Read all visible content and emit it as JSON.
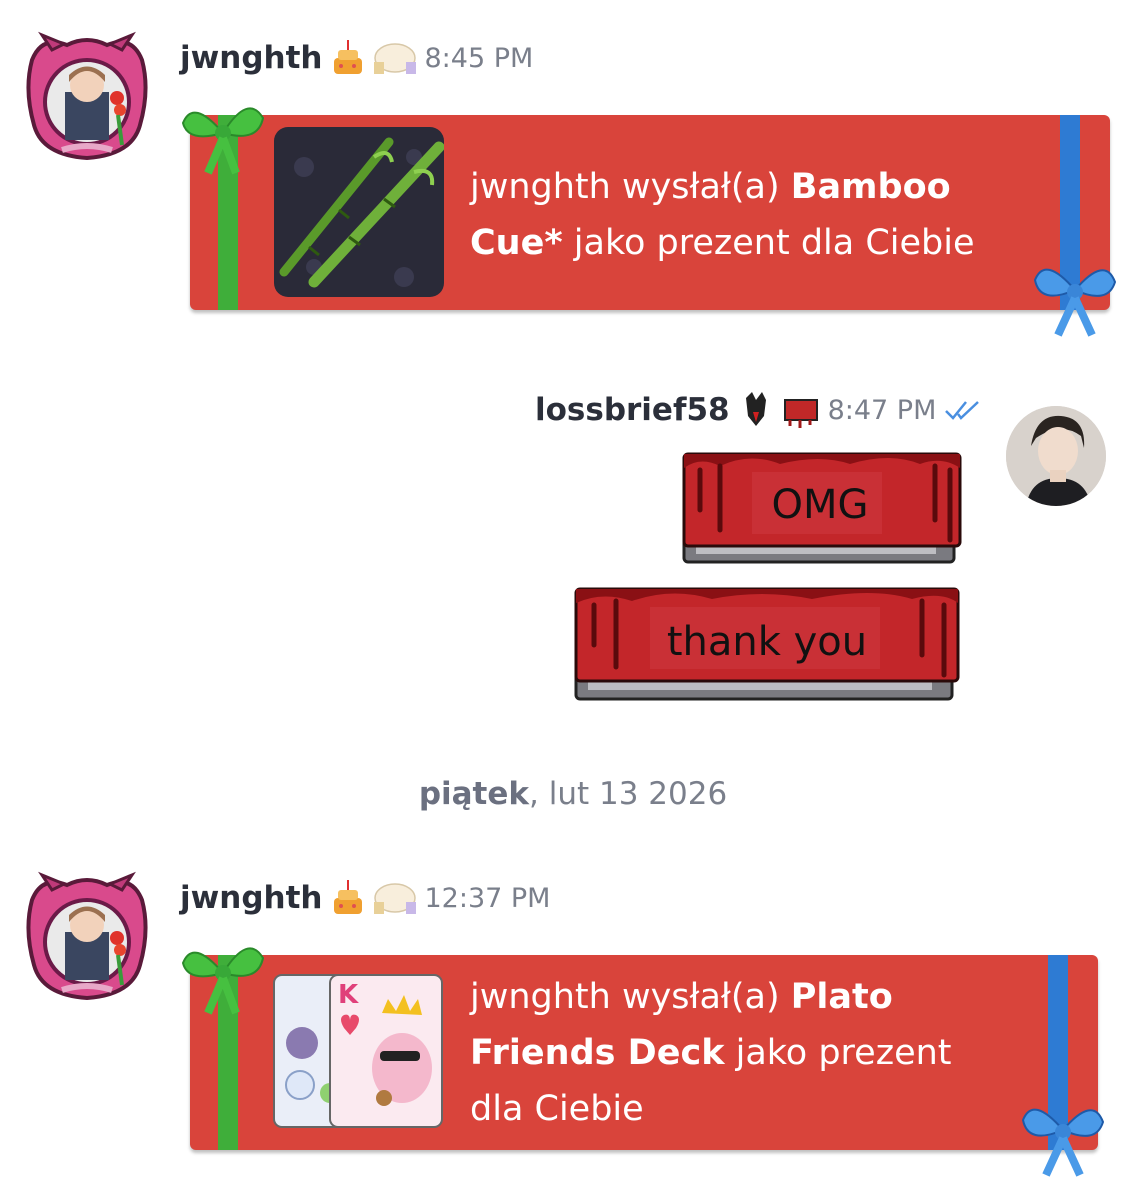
{
  "messages": [
    {
      "username": "jwnghth",
      "time": "8:45 PM",
      "gift": {
        "prefix": "jwnghth wysłał(a) ",
        "item": "Bamboo Cue*",
        "suffix": " jako prezent dla Ciebie",
        "thumbnail_icon": "bamboo-cue-icon"
      }
    },
    {
      "username": "lossbrief58",
      "time": "8:47 PM",
      "read_icon": "double-check-icon",
      "bubbles": [
        "OMG",
        "thank you"
      ]
    },
    {
      "username": "jwnghth",
      "time": "12:37 PM",
      "gift": {
        "prefix": "jwnghth wysłał(a) ",
        "item": "Plato Friends Deck",
        "suffix": " jako prezent dla Ciebie",
        "thumbnail_icon": "card-deck-icon"
      }
    }
  ],
  "date_separator": {
    "day": "piątek",
    "date": ", lut 13 2026"
  },
  "colors": {
    "gift_red": "#d9443b",
    "ribbon_green": "#3fae3a",
    "ribbon_blue": "#2e7bd3",
    "text_gray": "#7a7f8b"
  }
}
